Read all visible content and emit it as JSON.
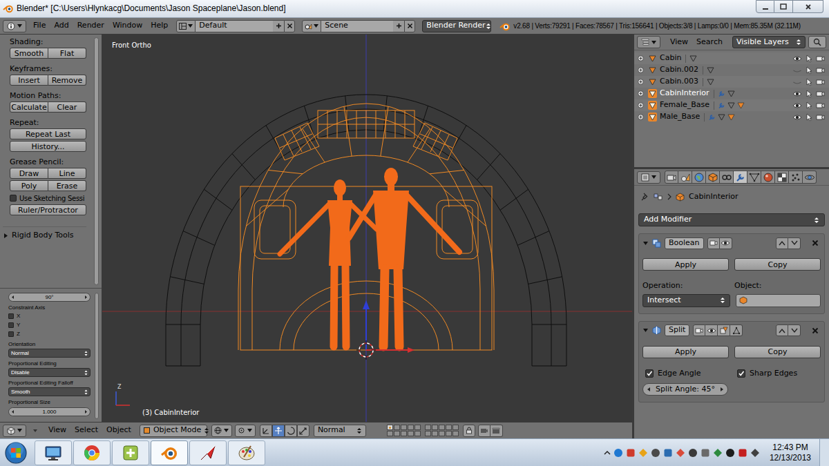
{
  "window": {
    "title": "Blender* [C:\\Users\\Hlynkacg\\Documents\\Jason Spaceplane\\Jason.blend]"
  },
  "info_header": {
    "menus": [
      "File",
      "Add",
      "Render",
      "Window",
      "Help"
    ],
    "screen_layout": "Default",
    "scene": "Scene",
    "render_engine": "Blender Render",
    "stats": "v2.68 | Verts:79291 | Faces:78567 | Tris:156641 | Objects:3/8 | Lamps:0/0 | Mem:85.35M (32.11M)"
  },
  "tool_shelf": [
    {
      "kind": "label",
      "text": "Shading:"
    },
    {
      "kind": "buttons",
      "items": [
        "Smooth",
        "Flat"
      ]
    },
    {
      "kind": "label",
      "text": "Keyframes:"
    },
    {
      "kind": "buttons",
      "items": [
        "Insert",
        "Remove"
      ]
    },
    {
      "kind": "label",
      "text": "Motion Paths:"
    },
    {
      "kind": "buttons",
      "items": [
        "Calculate",
        "Clear"
      ]
    },
    {
      "kind": "label",
      "text": "Repeat:"
    },
    {
      "kind": "buttons",
      "items": [
        "Repeat Last"
      ]
    },
    {
      "kind": "buttons",
      "items": [
        "History..."
      ]
    },
    {
      "kind": "label",
      "text": "Grease Pencil:"
    },
    {
      "kind": "buttons",
      "items": [
        "Draw",
        "Line"
      ]
    },
    {
      "kind": "buttons",
      "items": [
        "Poly",
        "Erase"
      ]
    },
    {
      "kind": "checkbox",
      "text": "Use Sketching Sessi",
      "checked": false
    },
    {
      "kind": "buttons",
      "items": [
        "Ruler/Protractor"
      ]
    },
    {
      "kind": "disclosure",
      "text": "Rigid Body Tools",
      "expanded": false
    }
  ],
  "operator_panel": [
    {
      "kind": "number",
      "text": "90°"
    },
    {
      "kind": "label",
      "text": "Constraint Axis"
    },
    {
      "kind": "checkbox",
      "text": "X",
      "checked": false
    },
    {
      "kind": "checkbox",
      "text": "Y",
      "checked": false
    },
    {
      "kind": "checkbox",
      "text": "Z",
      "checked": false
    },
    {
      "kind": "label",
      "text": "Orientation"
    },
    {
      "kind": "dropdown",
      "text": "Normal"
    },
    {
      "kind": "label",
      "text": "Proportional Editing"
    },
    {
      "kind": "dropdown",
      "text": "Disable"
    },
    {
      "kind": "label",
      "text": "Proportional Editing Falloff"
    },
    {
      "kind": "dropdown",
      "text": "Smooth"
    },
    {
      "kind": "label",
      "text": "Proportional Size"
    },
    {
      "kind": "number",
      "text": "1.000"
    }
  ],
  "viewport": {
    "view_name": "Front Ortho",
    "object_info": "(3) CabinInterior",
    "gizmo_axis": "Z"
  },
  "viewport_header": {
    "menus": [
      "View",
      "Select",
      "Object"
    ],
    "mode": "Object Mode",
    "transform_orientation": "Normal",
    "manipulators": [
      {
        "selected": false
      },
      {
        "selected": true
      },
      {
        "selected": false
      },
      {
        "selected": false
      }
    ],
    "layers": [
      {
        "active": true,
        "has_objects": true
      },
      {
        "active": false,
        "has_objects": false
      },
      {
        "active": false,
        "has_objects": false
      },
      {
        "active": false,
        "has_objects": false
      },
      {
        "active": false,
        "has_objects": false
      },
      {
        "active": false,
        "has_objects": false
      },
      {
        "active": false,
        "has_objects": false
      },
      {
        "active": false,
        "has_objects": false
      },
      {
        "active": false,
        "has_objects": false
      },
      {
        "active": false,
        "has_objects": false
      },
      {
        "active": false,
        "has_objects": false
      },
      {
        "active": false,
        "has_objects": false
      },
      {
        "active": false,
        "has_objects": false
      },
      {
        "active": false,
        "has_objects": false
      },
      {
        "active": false,
        "has_objects": false
      },
      {
        "active": false,
        "has_objects": false
      },
      {
        "active": false,
        "has_objects": false
      },
      {
        "active": false,
        "has_objects": false
      },
      {
        "active": false,
        "has_objects": false
      },
      {
        "active": false,
        "has_objects": false
      }
    ]
  },
  "outliner": {
    "menus": [
      "View",
      "Search"
    ],
    "filter": "Visible Layers",
    "rows": [
      {
        "name": "Cabin",
        "visible": true,
        "selected": false,
        "active": false,
        "modifiers": false,
        "materials": false
      },
      {
        "name": "Cabin.002",
        "visible": false,
        "selected": false,
        "active": false,
        "modifiers": false,
        "materials": false
      },
      {
        "name": "Cabin.003",
        "visible": false,
        "selected": false,
        "active": false,
        "modifiers": false,
        "materials": false
      },
      {
        "name": "CabinInterior",
        "visible": true,
        "selected": true,
        "active": true,
        "modifiers": true,
        "materials": false
      },
      {
        "name": "Female_Base",
        "visible": true,
        "selected": true,
        "active": false,
        "modifiers": true,
        "materials": true
      },
      {
        "name": "Male_Base",
        "visible": true,
        "selected": true,
        "active": false,
        "modifiers": true,
        "materials": true
      }
    ]
  },
  "properties": {
    "context_tabs": [
      {
        "selected": false
      },
      {
        "selected": false
      },
      {
        "selected": false
      },
      {
        "selected": false
      },
      {
        "selected": false
      },
      {
        "selected": true
      },
      {
        "selected": false
      },
      {
        "selected": false
      },
      {
        "selected": false
      },
      {
        "selected": false
      },
      {
        "selected": false
      }
    ],
    "breadcrumb": "CabinInterior",
    "add_modifier": "Add Modifier",
    "modifiers": [
      {
        "kind": "boolean",
        "name": "Boolean",
        "expanded": true,
        "actions": [
          "Apply",
          "Copy"
        ],
        "operation_label": "Operation:",
        "operation": "Intersect",
        "object_label": "Object:",
        "object": ""
      },
      {
        "kind": "split",
        "name": "Split",
        "expanded": true,
        "actions": [
          "Apply",
          "Copy"
        ],
        "options": [
          {
            "label": "Edge Angle",
            "checked": true
          },
          {
            "label": "Sharp Edges",
            "checked": true
          }
        ],
        "angle": "Split Angle: 45°"
      }
    ]
  },
  "taskbar": {
    "apps": [
      {
        "active": false
      },
      {
        "active": false
      },
      {
        "active": false
      },
      {
        "active": true
      },
      {
        "active": false
      },
      {
        "active": false
      }
    ],
    "clock": {
      "time": "12:43 PM",
      "date": "12/13/2013"
    }
  }
}
